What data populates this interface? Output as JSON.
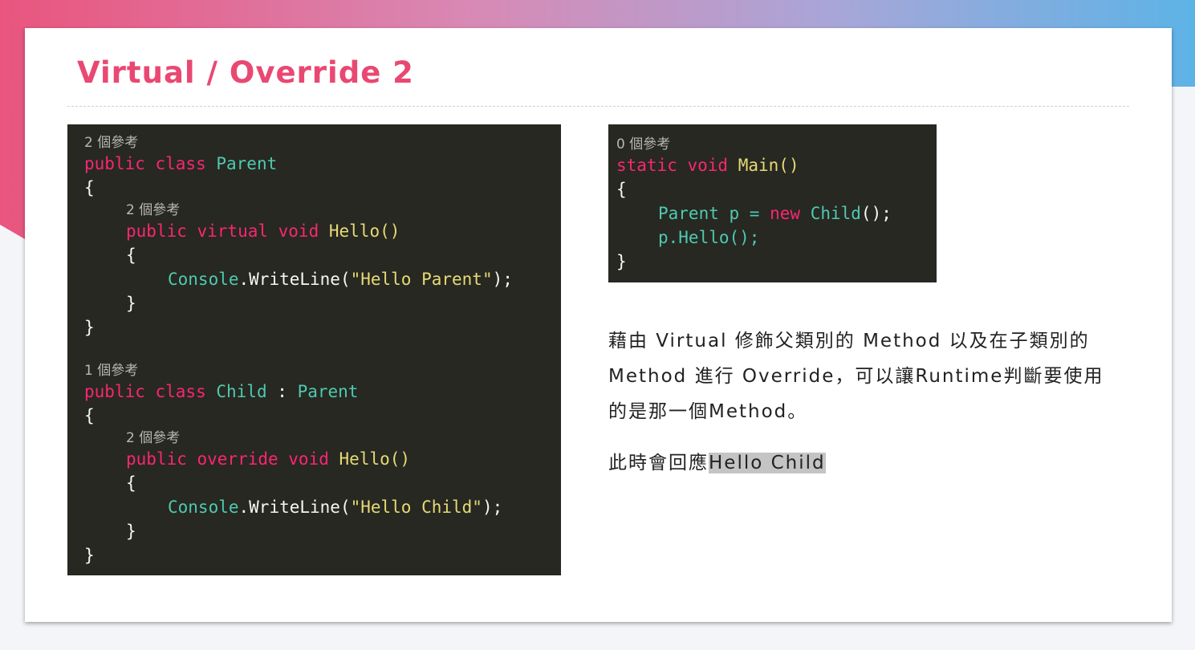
{
  "slide": {
    "title": "Virtual / Override 2",
    "description": "藉由 Virtual 修飾父類別的 Method 以及在子類別的 Method 進行 Override，可以讓Runtime判斷要使用的是那一個Method。",
    "note_prefix": "此時會回應",
    "note_highlight": "Hello Child"
  },
  "code_left": {
    "parent_refs": "2 個參考",
    "parent_class_keywords": "public class",
    "parent_class_name": "Parent",
    "open_brace_1": "{",
    "hello_refs_1": "2 個參考",
    "hello_modifiers_1": "public virtual void",
    "hello_method_1": "Hello()",
    "open_brace_2": "{",
    "console_1": "Console",
    "writeline_1": ".WriteLine(",
    "string_1": "\"Hello Parent\"",
    "end_1": ");",
    "close_brace_2": "}",
    "close_brace_1": "}",
    "child_refs": "1 個參考",
    "child_class_keywords": "public class",
    "child_class_name": "Child",
    "inherit_colon": ":",
    "child_base_name": "Parent",
    "open_brace_3": "{",
    "hello_refs_2": "2 個參考",
    "hello_modifiers_2": "public override void",
    "hello_method_2": "Hello()",
    "open_brace_4": "{",
    "console_2": "Console",
    "writeline_2": ".WriteLine(",
    "string_2": "\"Hello Child\"",
    "end_2": ");",
    "close_brace_4": "}",
    "close_brace_3": "}"
  },
  "code_right": {
    "main_refs": "0 個參考",
    "main_modifiers": "static void",
    "main_method": "Main()",
    "open_brace": "{",
    "var_type": "Parent",
    "var_assign": "p =",
    "new_kw": "new",
    "new_type": "Child",
    "new_end": "();",
    "call_stmt": "p.Hello();",
    "close_brace": "}"
  }
}
